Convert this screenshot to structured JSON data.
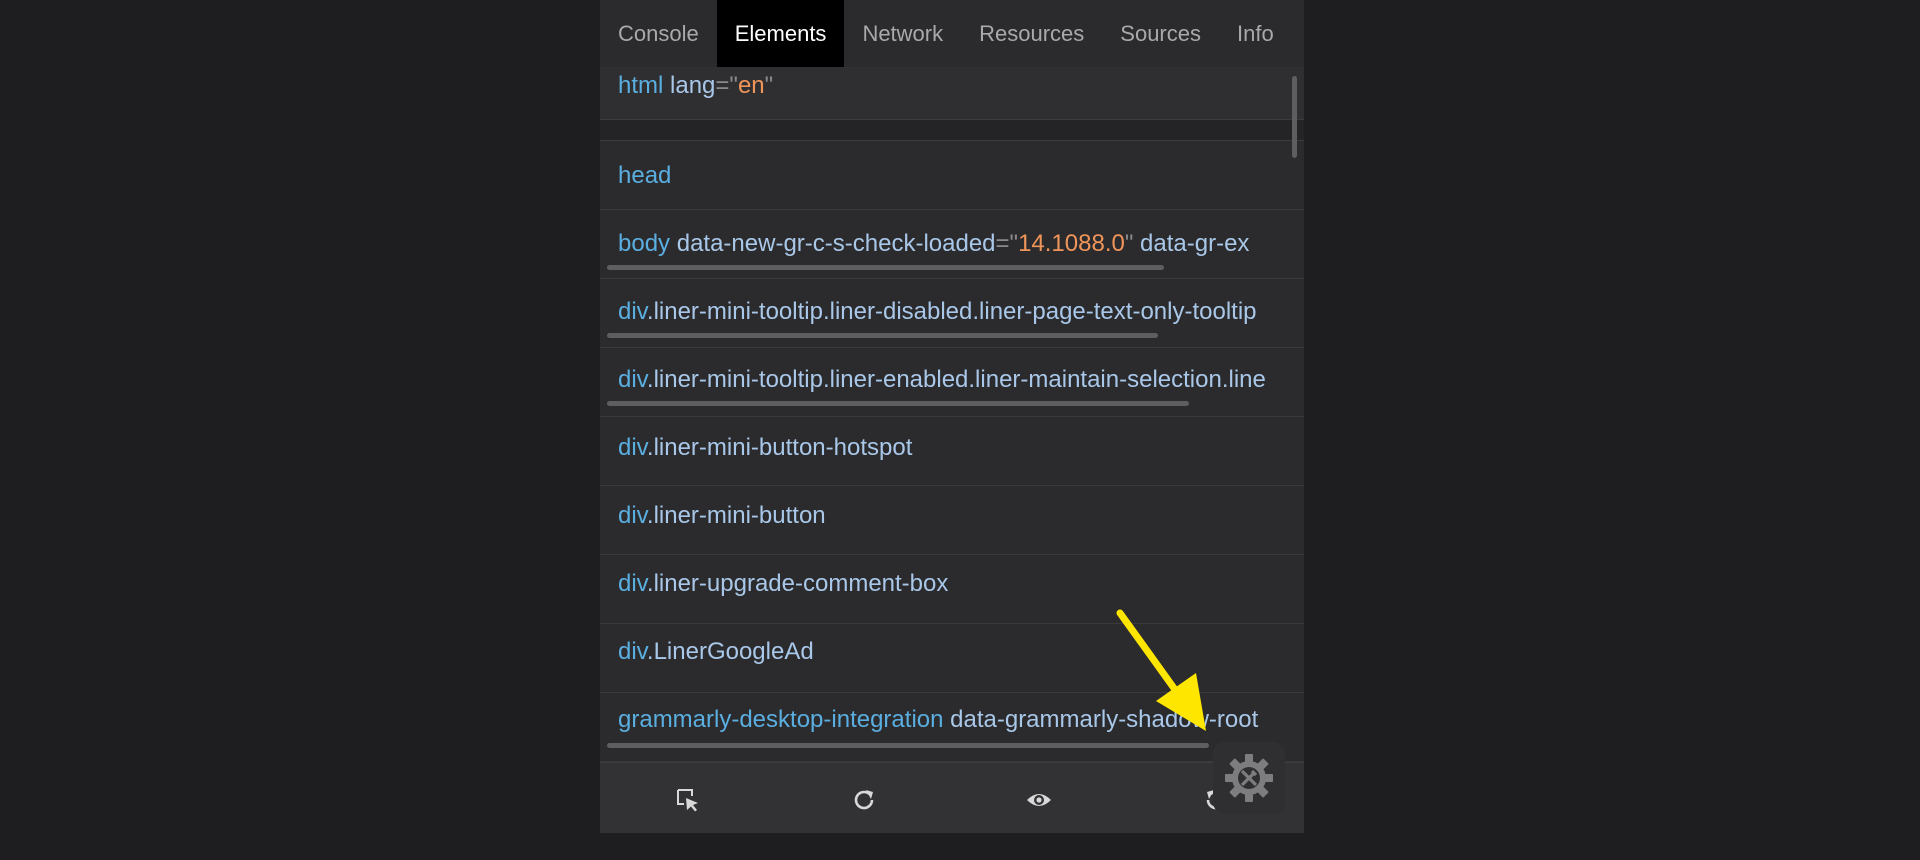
{
  "tabs": [
    {
      "label": "Console",
      "active": false
    },
    {
      "label": "Elements",
      "active": true
    },
    {
      "label": "Network",
      "active": false
    },
    {
      "label": "Resources",
      "active": false
    },
    {
      "label": "Sources",
      "active": false
    },
    {
      "label": "Info",
      "active": false
    }
  ],
  "tree": {
    "html": {
      "tag": "html",
      "attr": "lang",
      "eq": "=",
      "q1": "\"",
      "val": "en",
      "q2": "\""
    },
    "head": {
      "tag": "head"
    },
    "body": {
      "tag": "body",
      "attr1": "data-new-gr-c-s-check-loaded",
      "eq": "=",
      "q1": "\"",
      "val1": "14.1088.0",
      "q2": "\"",
      "attr2": "data-gr-ex"
    },
    "div1": {
      "tag": "div",
      "cls": ".liner-mini-tooltip.liner-disabled.liner-page-text-only-tooltip"
    },
    "div2": {
      "tag": "div",
      "cls": ".liner-mini-tooltip.liner-enabled.liner-maintain-selection.line"
    },
    "div3": {
      "tag": "div",
      "cls": ".liner-mini-button-hotspot"
    },
    "div4": {
      "tag": "div",
      "cls": ".liner-mini-button"
    },
    "div5": {
      "tag": "div",
      "cls": ".liner-upgrade-comment-box"
    },
    "div6": {
      "tag": "div",
      "cls": ".LinerGoogleAd"
    },
    "grammarly": {
      "tag": "grammarly-desktop-integration",
      "attr": "data-grammarly-shadow-root"
    }
  },
  "toolbar": {
    "icons": [
      "select-element-icon",
      "refresh-icon",
      "eye-icon",
      "reset-icon"
    ]
  },
  "floating": {
    "icon": "gear-tools-icon"
  },
  "annotation": {
    "icon": "yellow-arrow",
    "color": "#ffe600"
  },
  "colors": {
    "tag": "#5aaee0",
    "attr": "#a9c7e8",
    "value": "#f0955a",
    "active_tab_bg": "#000000"
  }
}
